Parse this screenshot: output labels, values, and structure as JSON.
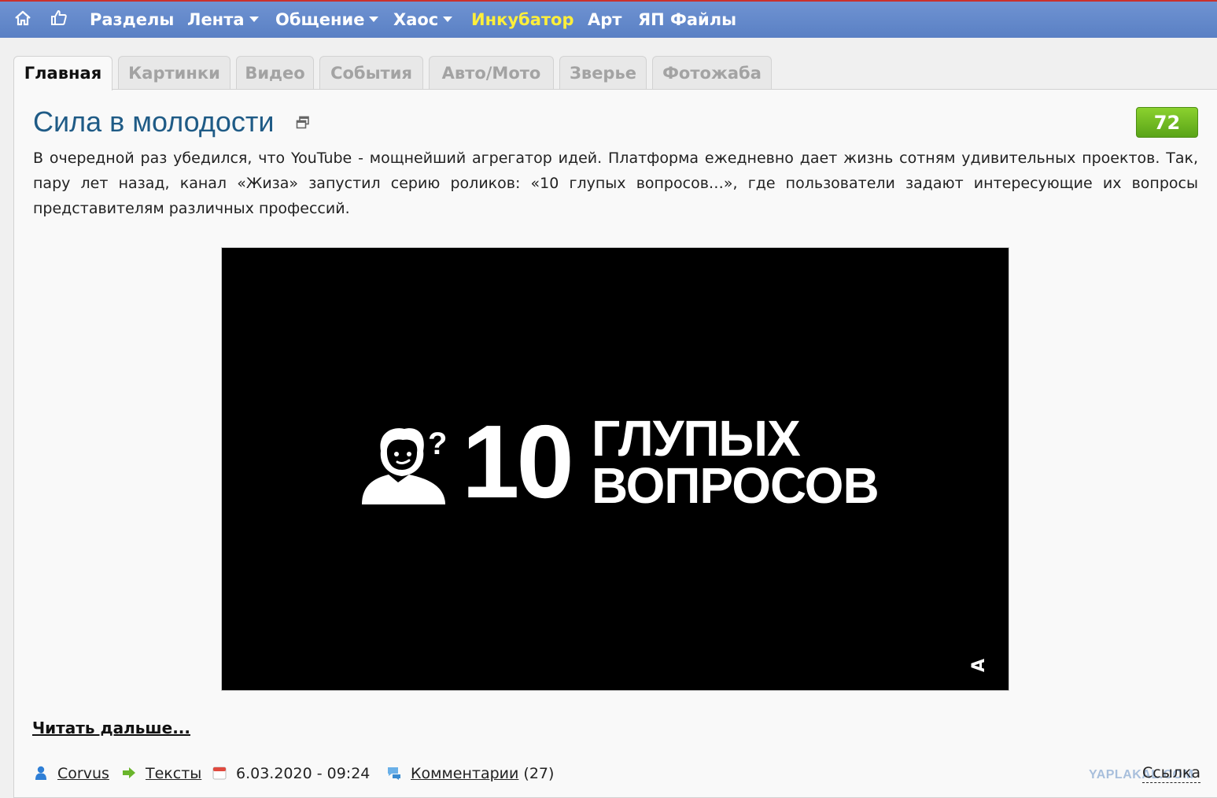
{
  "nav": {
    "items": [
      {
        "label": "Разделы"
      },
      {
        "label": "Лента"
      },
      {
        "label": "Общение"
      },
      {
        "label": "Хаос"
      },
      {
        "label": "Инкубатор"
      },
      {
        "label": "Арт"
      },
      {
        "label": "ЯП Файлы"
      }
    ]
  },
  "tabs": [
    {
      "label": "Главная",
      "active": true
    },
    {
      "label": "Картинки"
    },
    {
      "label": "Видео"
    },
    {
      "label": "События"
    },
    {
      "label": "Авто/Мото"
    },
    {
      "label": "Зверье"
    },
    {
      "label": "Фотожаба"
    }
  ],
  "post": {
    "title": "Сила в молодости",
    "score": "72",
    "body": "В очередной раз убедился, что YouTube - мощнейший агрегатор идей. Платформа ежедневно дает жизнь сотням удивительных проектов. Так, пару лет назад, канал «Жиза» запустил серию роликов: «10 глупых вопросов…», где пользователи задают интересующие их вопросы представителям различных профессий.",
    "video": {
      "number": "10",
      "line1": "ГЛУПЫХ",
      "line2": "ВОПРОСОВ",
      "corner_mark": "A"
    },
    "read_more": "Читать дальше...",
    "meta": {
      "author": "Corvus",
      "section": "Тексты",
      "date": "6.03.2020 - 09:24",
      "comments_label": "Комментарии",
      "comments_count": "(27)",
      "link_label": "Ссылка",
      "watermark": "YAPLAKAL.COM"
    }
  },
  "colors": {
    "nav_bg": "#5f86c8",
    "nav_highlight": "#ffef3a",
    "title": "#1f5b86",
    "score_bg": "#6cb920"
  }
}
